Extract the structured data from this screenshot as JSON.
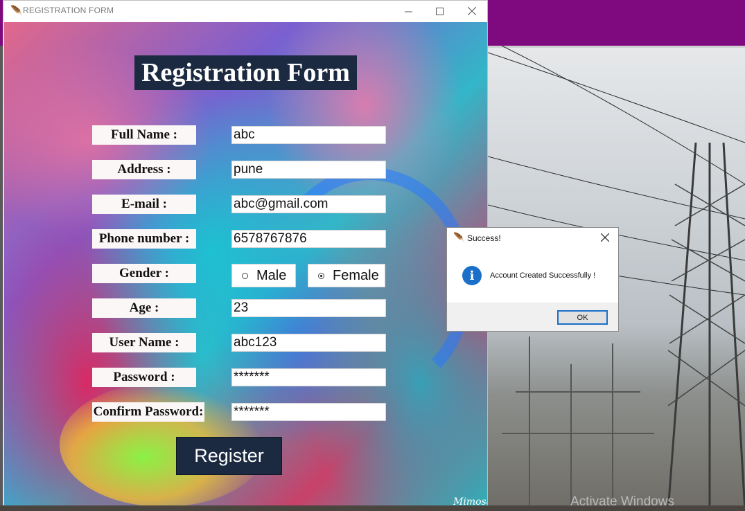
{
  "window": {
    "title": "REGISTRATION FORM",
    "icon": "feather-icon"
  },
  "form": {
    "heading": "Registration Form",
    "fields": [
      {
        "label": "Full Name :",
        "value": "abc"
      },
      {
        "label": "Address :",
        "value": "pune"
      },
      {
        "label": "E-mail :",
        "value": "abc@gmail.com"
      },
      {
        "label": "Phone number :",
        "value": "6578767876"
      },
      {
        "label": "Gender :"
      },
      {
        "label": "Age :",
        "value": "23"
      },
      {
        "label": "User Name :",
        "value": "abc123"
      },
      {
        "label": "Password :",
        "value": "*******"
      },
      {
        "label": "Confirm Password:",
        "value": "*******"
      }
    ],
    "gender_options": [
      {
        "label": "Male",
        "selected": false
      },
      {
        "label": "Female",
        "selected": true
      }
    ],
    "register_label": "Register",
    "background_signature": "Mimosa"
  },
  "dialog": {
    "title": "Success!",
    "message": "Account Created Successfully !",
    "ok_label": "OK",
    "icon": "info-icon"
  },
  "desktop": {
    "watermark": "Activate Windows"
  },
  "colors": {
    "heading_bg": "#1b2a40",
    "desktop_top_bar": "#7f0a7f",
    "dialog_accent": "#1a6fc9"
  }
}
